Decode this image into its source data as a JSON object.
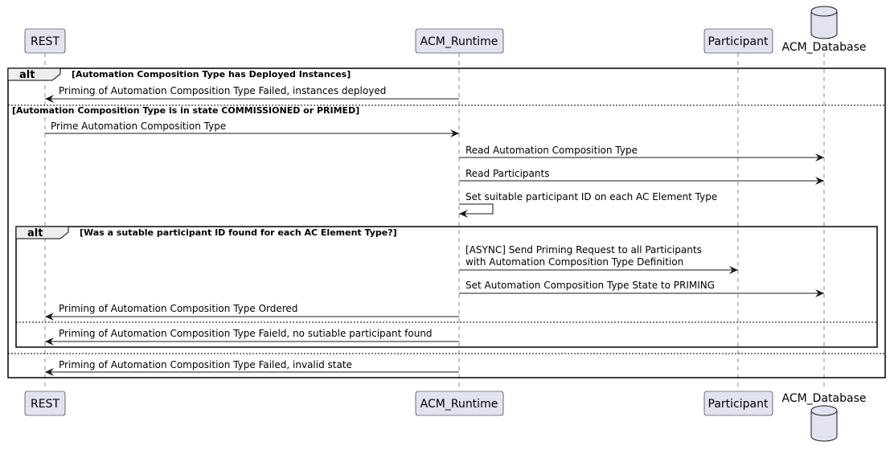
{
  "participants": {
    "rest": {
      "label": "REST",
      "kind": "participant"
    },
    "runtime": {
      "label": "ACM_Runtime",
      "kind": "participant"
    },
    "participant": {
      "label": "Participant",
      "kind": "participant"
    },
    "database": {
      "label": "ACM_Database",
      "kind": "database"
    }
  },
  "colors": {
    "participant_fill": "#E2E2F0",
    "participant_border": "#181818",
    "lifeline": "#888888",
    "line": "#181818"
  },
  "fragments": {
    "outer": {
      "keyword": "alt",
      "guard1": "[Automation Composition Type has Deployed Instances]",
      "guard2": "[Automation Composition Type is in state COMMISSIONED or PRIMED]"
    },
    "inner": {
      "keyword": "alt",
      "guard1": "[Was a sutable participant ID found for each AC Element Type?]"
    }
  },
  "messages": {
    "m1": "Priming of Automation Composition Type Failed, instances deployed",
    "m2": "Prime Automation Composition Type",
    "m3": "Read Automation Composition Type",
    "m4": "Read Participants",
    "m5": "Set suitable participant ID on each AC Element Type",
    "m6_line1": "[ASYNC] Send Priming Request to all Participants",
    "m6_line2": "with Automation Composition Type Definition",
    "m7": "Set Automation Composition Type State to PRIMING",
    "m8": "Priming of Automation Composition Type Ordered",
    "m9": "Priming of Automation Composition Type Faield, no sutiable participant found",
    "m10": "Priming of Automation Composition Type Failed, invalid state"
  }
}
